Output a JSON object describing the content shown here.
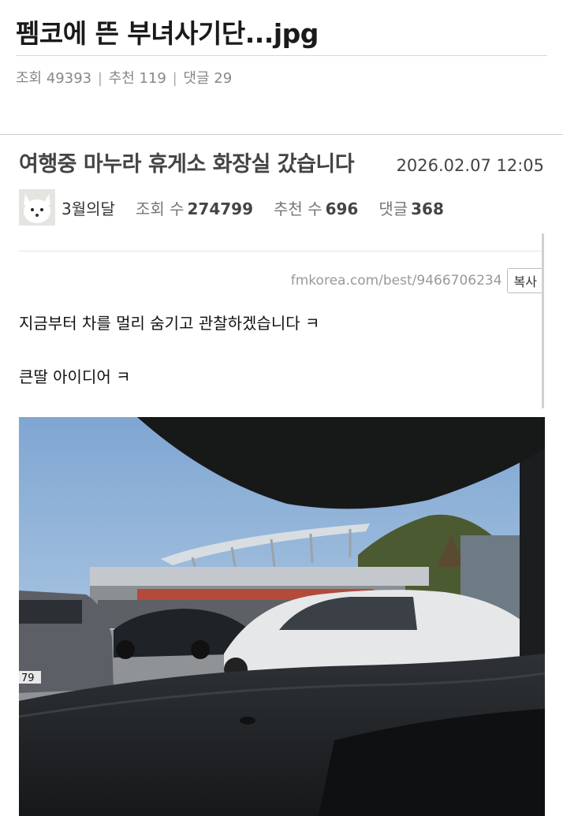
{
  "outer": {
    "title": "펨코에 뜬 부녀사기단...jpg",
    "views_label": "조회 49393",
    "recommend_label": "추천 119",
    "comments_label": "댓글 29",
    "sep": "|"
  },
  "post": {
    "title": "여행중 마누라 휴게소 화장실 갔습니다",
    "date": "2026.02.07 12:05",
    "author": "3월의달",
    "stats": {
      "views_label": "조회 수",
      "views": "274799",
      "recommend_label": "추천 수",
      "recommend": "696",
      "comments_label": "댓글",
      "comments": "368"
    },
    "source_url": "fmkorea.com/best/9466706234",
    "copy_label": "복사",
    "paragraphs": [
      "지금부터 차를 멀리 숨기고 관찰하겠습니다 ㅋ",
      "큰딸 아이디어 ㅋ"
    ]
  },
  "photo": {
    "plate_text": "79"
  },
  "colors": {
    "accent_text": "#444444",
    "muted": "#999999",
    "sky": "#a9c7e4"
  }
}
